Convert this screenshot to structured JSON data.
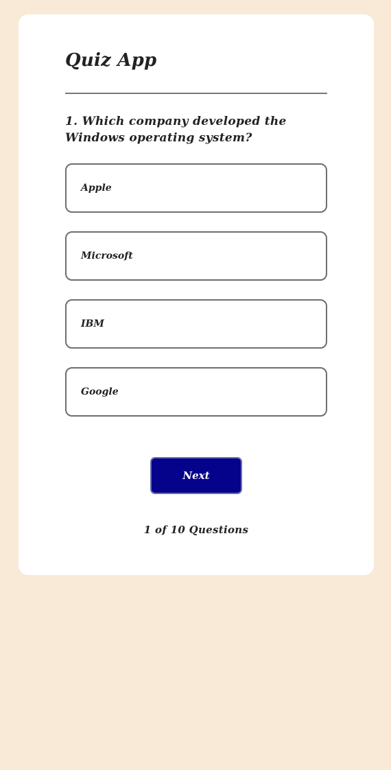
{
  "app": {
    "title": "Quiz App"
  },
  "question": {
    "text": "1. Which company developed the Windows operating system?"
  },
  "options": [
    {
      "label": "Apple"
    },
    {
      "label": "Microsoft"
    },
    {
      "label": "IBM"
    },
    {
      "label": "Google"
    }
  ],
  "controls": {
    "next_label": "Next"
  },
  "progress": {
    "text": "1 of 10 Questions"
  },
  "colors": {
    "page_background": "#f9ead7",
    "card_background": "#ffffff",
    "next_button": "#05038c",
    "option_border": "#6e6e6e"
  }
}
